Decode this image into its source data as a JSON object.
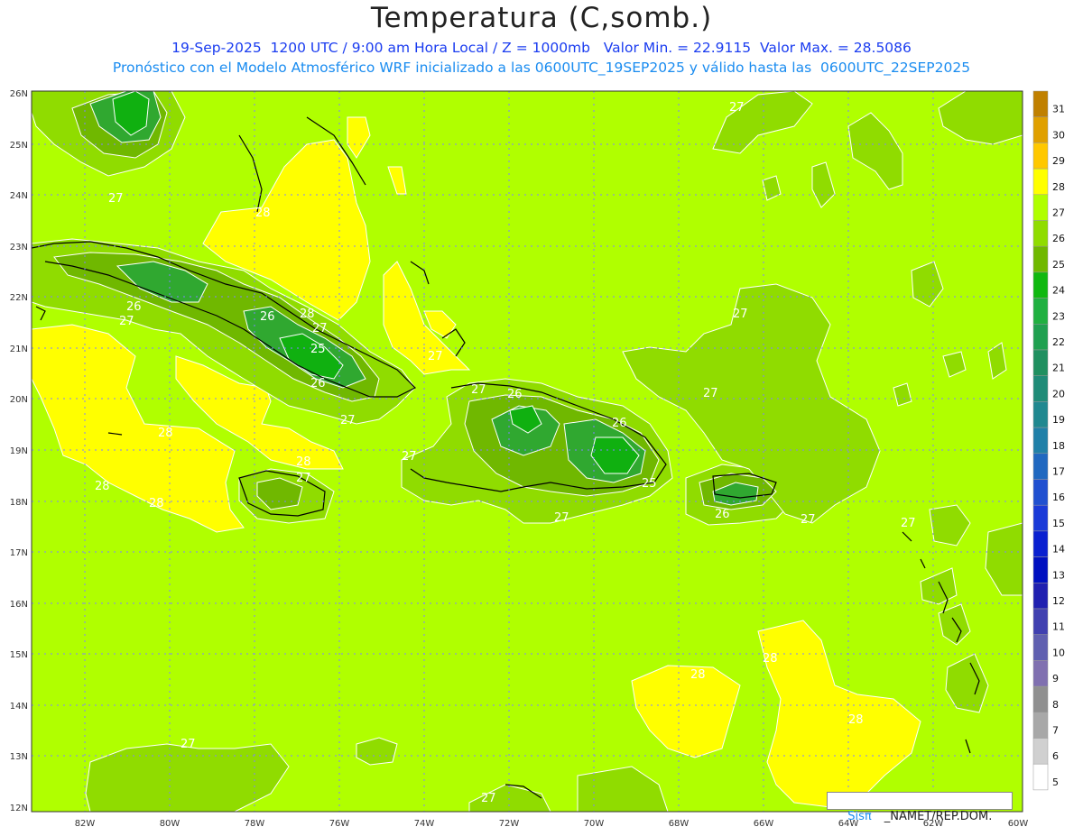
{
  "title": "Temperatura (C,somb.)",
  "subtitle_line1": "19-Sep-2025  1200 UTC / 9:00 am Hora Local / Z = 1000mb   Valor Min. = 22.9115  Valor Max. = 28.5086",
  "subtitle_line2": "Pronóstico con el Modelo Atmosférico WRF inicializado a las 0600UTC_19SEP2025 y válido hasta las  0600UTC_22SEP2025",
  "brand_left": "Sisπ",
  "brand_right": "_NAMET/REP.DOM.",
  "lat_labels": [
    "26N",
    "25N",
    "24N",
    "23N",
    "22N",
    "21N",
    "20N",
    "19N",
    "18N",
    "17N",
    "16N",
    "15N",
    "14N",
    "13N",
    "12N"
  ],
  "lon_labels": [
    "82W",
    "80W",
    "78W",
    "76W",
    "74W",
    "72W",
    "70W",
    "68W",
    "66W",
    "64W",
    "62W",
    "60W"
  ],
  "colorbar": {
    "levels": [
      "31",
      "30",
      "29",
      "28",
      "27",
      "26",
      "25",
      "24",
      "23",
      "22",
      "21",
      "20",
      "19",
      "18",
      "17",
      "16",
      "15",
      "14",
      "13",
      "12",
      "11",
      "10",
      "9",
      "8",
      "7",
      "6",
      "5"
    ],
    "colors": [
      "#c08000",
      "#e0a000",
      "#ffc800",
      "#ffff00",
      "#b0ff00",
      "#90dc00",
      "#70b800",
      "#10b810",
      "#20b040",
      "#20a050",
      "#209060",
      "#208c78",
      "#208890",
      "#2080a8",
      "#2068c0",
      "#2050d0",
      "#1a3ad8",
      "#0a20d0",
      "#0010c0",
      "#2020b0",
      "#4040b0",
      "#6060b0",
      "#8070b0",
      "#909090",
      "#a8a8a8",
      "#d0d0d0",
      "#ffffff"
    ]
  },
  "field_colors": {
    "base": "#b0ff00",
    "warm28": "#ffff00",
    "t26_27": "#90dc00",
    "t25_26": "#70b800",
    "t24_25": "#30a830",
    "t23_24": "#10b010"
  },
  "contour_labels": [
    "27",
    "27",
    "28",
    "26",
    "27",
    "26",
    "28",
    "27",
    "25",
    "26",
    "27",
    "28",
    "28",
    "28",
    "28",
    "27",
    "27",
    "27",
    "26",
    "27",
    "26",
    "25",
    "27",
    "26",
    "27",
    "27",
    "27",
    "28",
    "28",
    "28",
    "27",
    "27",
    "27"
  ]
}
